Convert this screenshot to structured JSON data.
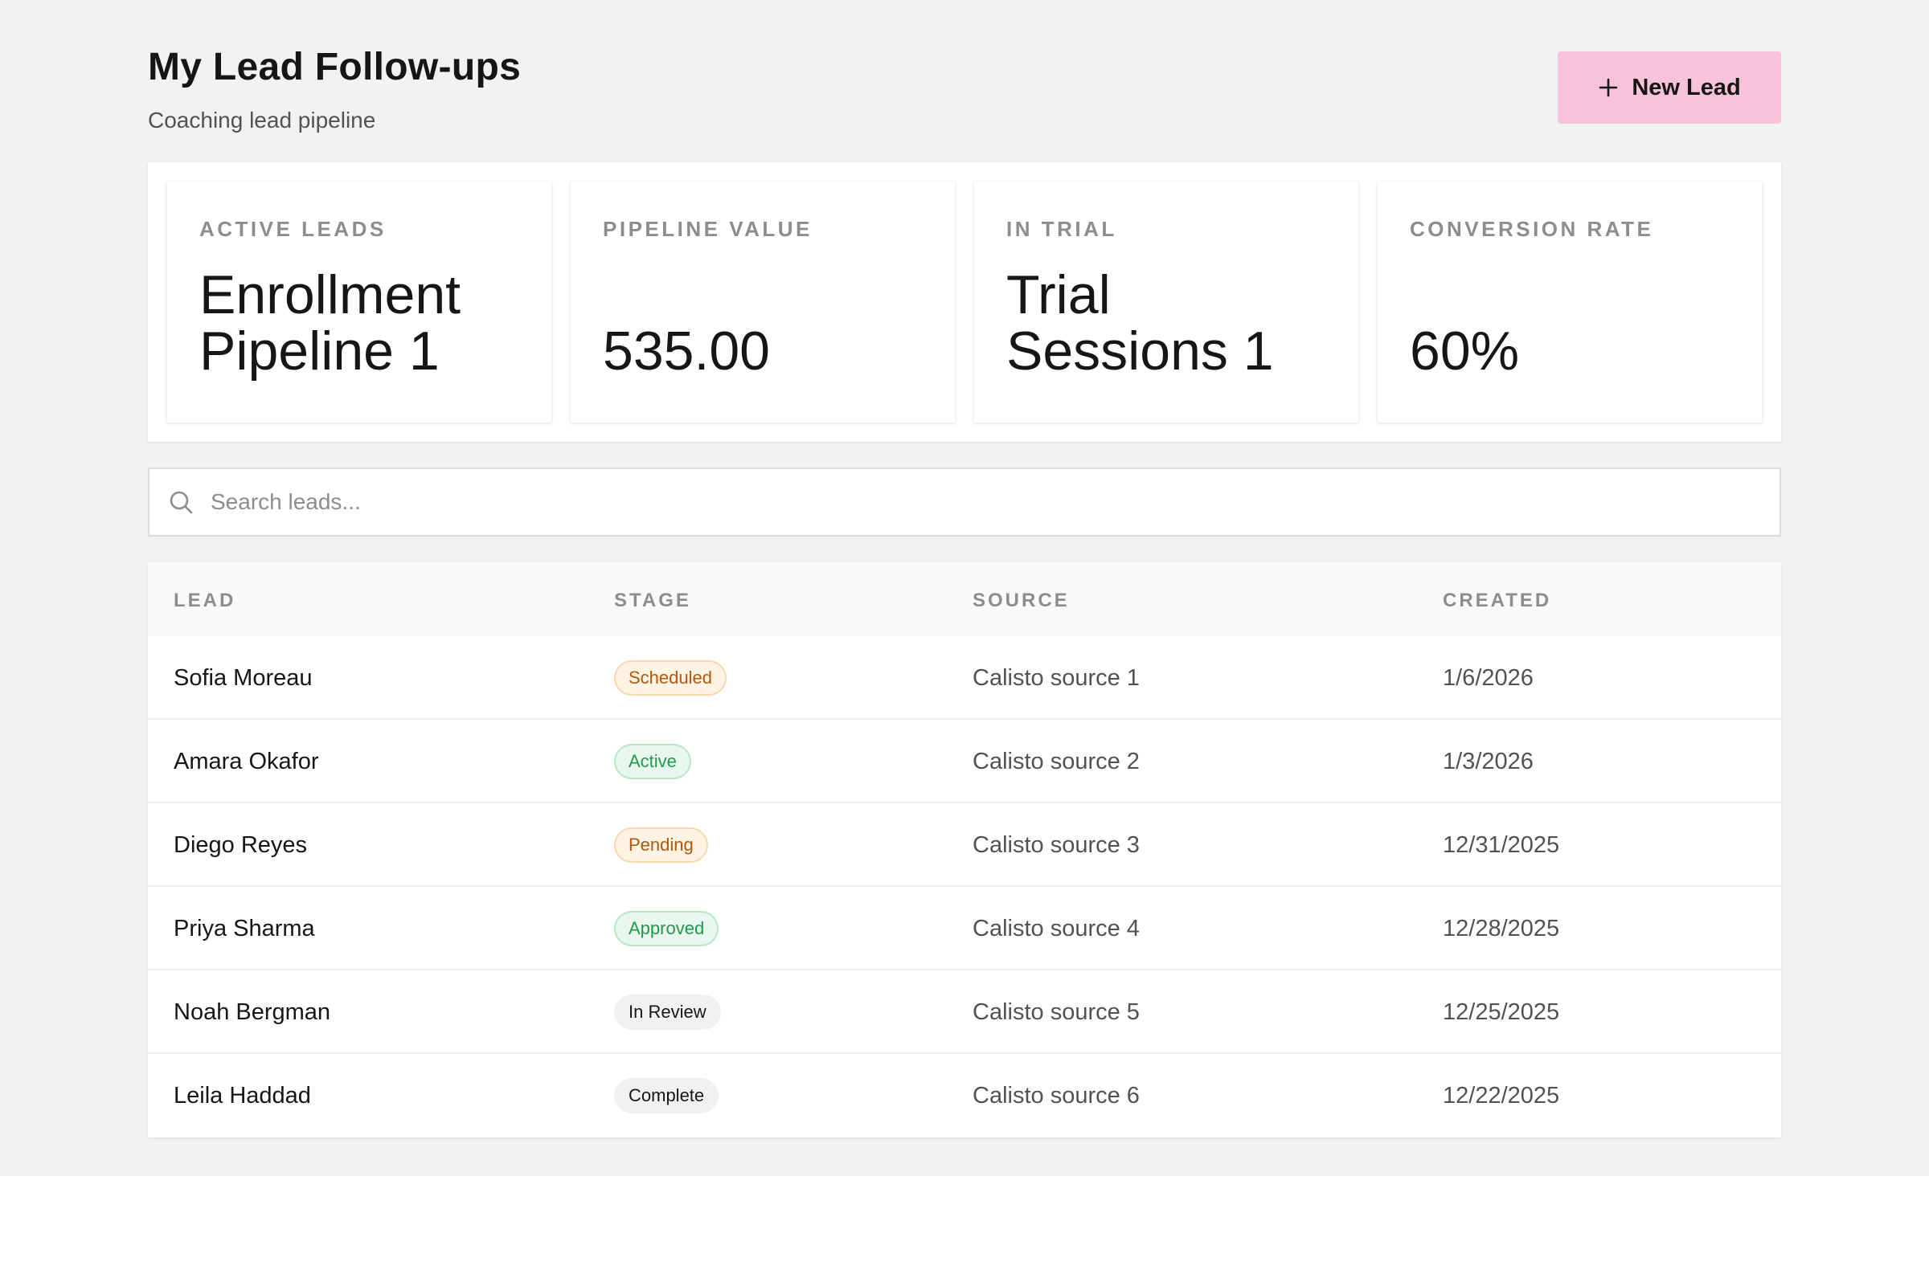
{
  "header": {
    "title": "My Lead Follow-ups",
    "subtitle": "Coaching lead pipeline",
    "new_button_label": "New Lead",
    "new_button_icon": "plus-icon"
  },
  "kpis": [
    {
      "label": "ACTIVE LEADS",
      "value": "Enrollment Pipeline 1"
    },
    {
      "label": "PIPELINE VALUE",
      "value": "535.00"
    },
    {
      "label": "IN TRIAL",
      "value": "Trial Sessions 1"
    },
    {
      "label": "CONVERSION RATE",
      "value": "60%"
    }
  ],
  "search": {
    "placeholder": "Search leads...",
    "value": "",
    "icon": "search-icon"
  },
  "table": {
    "columns": [
      "LEAD",
      "STAGE",
      "SOURCE",
      "CREATED"
    ],
    "rows": [
      {
        "lead": "Sofia Moreau",
        "stage": "Scheduled",
        "stage_color": "orange",
        "source": "Calisto source 1",
        "created": "1/6/2026"
      },
      {
        "lead": "Amara Okafor",
        "stage": "Active",
        "stage_color": "green",
        "source": "Calisto source 2",
        "created": "1/3/2026"
      },
      {
        "lead": "Diego Reyes",
        "stage": "Pending",
        "stage_color": "orange",
        "source": "Calisto source 3",
        "created": "12/31/2025"
      },
      {
        "lead": "Priya Sharma",
        "stage": "Approved",
        "stage_color": "green",
        "source": "Calisto source 4",
        "created": "12/28/2025"
      },
      {
        "lead": "Noah Bergman",
        "stage": "In Review",
        "stage_color": "gray",
        "source": "Calisto source 5",
        "created": "12/25/2025"
      },
      {
        "lead": "Leila Haddad",
        "stage": "Complete",
        "stage_color": "gray",
        "source": "Calisto source 6",
        "created": "12/22/2025"
      }
    ]
  },
  "colors": {
    "accent_button": "#f6c3d8",
    "page_background": "#f2f2f2",
    "badge_orange": "#b5570a",
    "badge_green": "#1f9a4a"
  }
}
